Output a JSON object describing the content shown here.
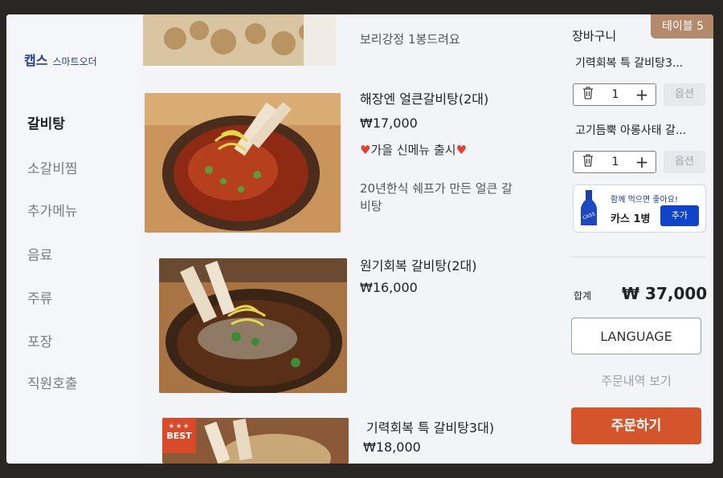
{
  "brand": {
    "logo": "캡스",
    "subtitle": "스마트오더"
  },
  "nav": {
    "items": [
      {
        "label": "갈비탕",
        "active": true
      },
      {
        "label": "소갈비찜",
        "active": false
      },
      {
        "label": "추가메뉴",
        "active": false
      },
      {
        "label": "음료",
        "active": false
      },
      {
        "label": "주류",
        "active": false
      },
      {
        "label": "포장",
        "active": false
      },
      {
        "label": "직원호출",
        "active": false
      }
    ]
  },
  "menu": {
    "partial_top_desc": "보리강정  1봉드려요",
    "items": [
      {
        "name": "해장엔 얼큰갈비탕(2대)",
        "price": "₩17,000",
        "promo": "가을 신메뉴 출시",
        "description": "20년한식 쉐프가 만든 얼큰 갈비탕"
      },
      {
        "name": "원기회복  갈비탕(2대)",
        "price": "₩16,000"
      },
      {
        "name": "기력회복 특 갈비탕3대)",
        "price": "₩18,000",
        "badge": "BEST",
        "badge_stars": "★★★"
      }
    ]
  },
  "cart": {
    "table_label": "테이블 5",
    "title": "장바구니",
    "items": [
      {
        "name": "기력회복 특 갈비탕3...",
        "qty": "1",
        "option_label": "옵션"
      },
      {
        "name": "고기듬뿍 아롱사태 갈...",
        "qty": "1",
        "option_label": "옵션"
      }
    ],
    "promo": {
      "headline": "함께 먹으면 좋아요!",
      "product": "카스 1병",
      "button": "추가",
      "bottle_text": "CASS"
    },
    "total_label": "합계",
    "total_value": "₩ 37,000",
    "language_button": "LANGUAGE",
    "history_button": "주문내역 보기",
    "order_button": "주문하기"
  },
  "colors": {
    "accent_order": "#d4542b",
    "add_button": "#1143c8",
    "table_tab": "#b58a6c",
    "brand": "#1f3f9a"
  }
}
